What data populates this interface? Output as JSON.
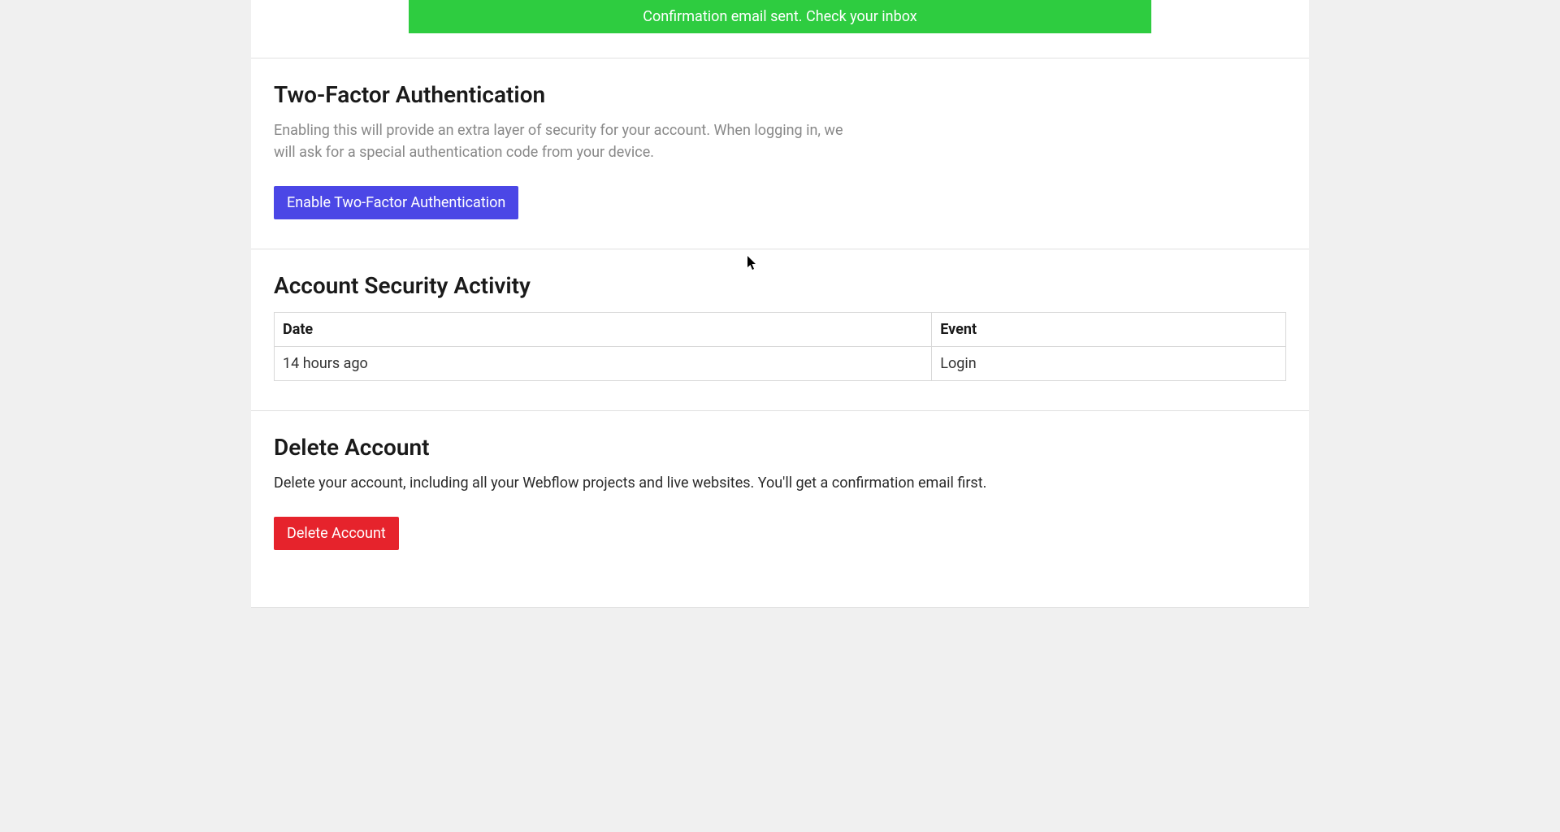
{
  "alert": {
    "message": "Confirmation email sent. Check your inbox"
  },
  "two_factor": {
    "title": "Two-Factor Authentication",
    "description": "Enabling this will provide an extra layer of security for your account. When logging in, we will ask for a special authentication code from your device.",
    "button_label": "Enable Two-Factor Authentication"
  },
  "activity": {
    "title": "Account Security Activity",
    "headers": {
      "date": "Date",
      "event": "Event"
    },
    "rows": [
      {
        "date": "14 hours ago",
        "event": "Login"
      }
    ]
  },
  "delete": {
    "title": "Delete Account",
    "description": "Delete your account, including all your Webflow projects and live websites. You'll get a confirmation email first.",
    "button_label": "Delete Account"
  }
}
